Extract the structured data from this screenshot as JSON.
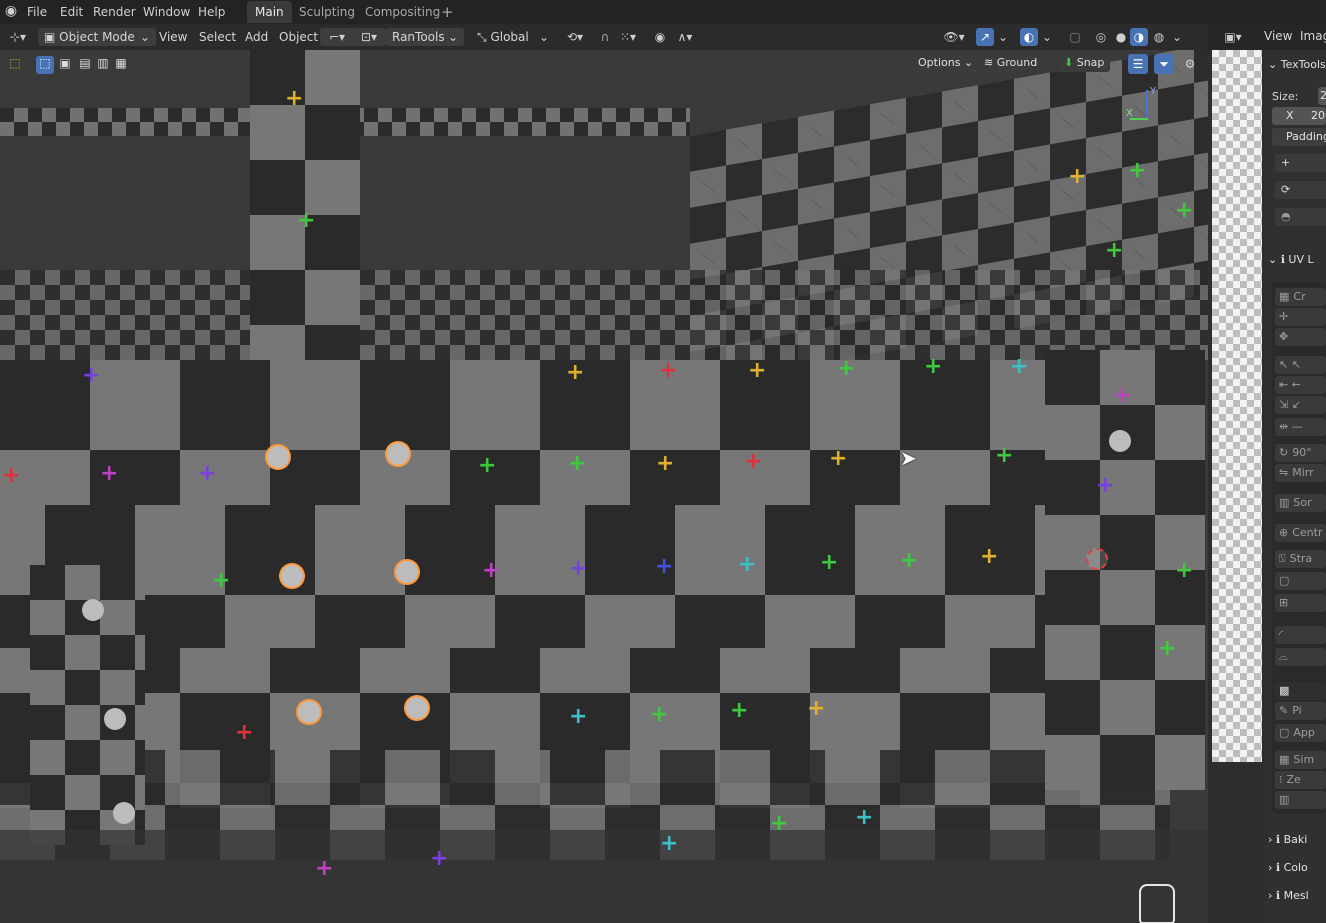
{
  "menu": {
    "items": [
      "File",
      "Edit",
      "Render",
      "Window",
      "Help"
    ],
    "workspaces": [
      "Main",
      "Sculpting",
      "Compositing"
    ],
    "active_workspace": "Main",
    "add_workspace": "+"
  },
  "viewport_header": {
    "mode": "Object Mode",
    "menus": [
      "View",
      "Select",
      "Add",
      "Object"
    ],
    "addon": "RanTools",
    "orientation": "Global"
  },
  "tool_row": {
    "options": "Options",
    "ground": "Ground",
    "snap": "Snap"
  },
  "nav_gizmo": {
    "x_label": "X",
    "y_label": "Y"
  },
  "right_panel": {
    "header_menus": [
      "View",
      "Imag"
    ],
    "textools_title": "TexTools",
    "size_label": "Size:",
    "size_value": "2",
    "x_label": "X",
    "x_value": "20",
    "padding_label": "Padding",
    "uv_section": "UV L",
    "tool_labels": [
      "Cr",
      "90°",
      "Mirr",
      "Sor",
      "Centr",
      "Stra",
      "Pi",
      "App",
      "Sim",
      "Ze"
    ],
    "bottom_sections": [
      "Baki",
      "Colo",
      "Mesl"
    ]
  },
  "colors": {
    "accent_blue": "#4772b3",
    "selection_orange": "#ff9a3c",
    "checker_dark": "#2a2a2a",
    "checker_light": "#777777",
    "cross_red": "#e0303a",
    "cross_green": "#3fc93f",
    "cross_yellow": "#e0b030",
    "cross_purple": "#7a3fe0",
    "cross_magenta": "#c23fc2",
    "cross_cyan": "#3fc0c8"
  }
}
